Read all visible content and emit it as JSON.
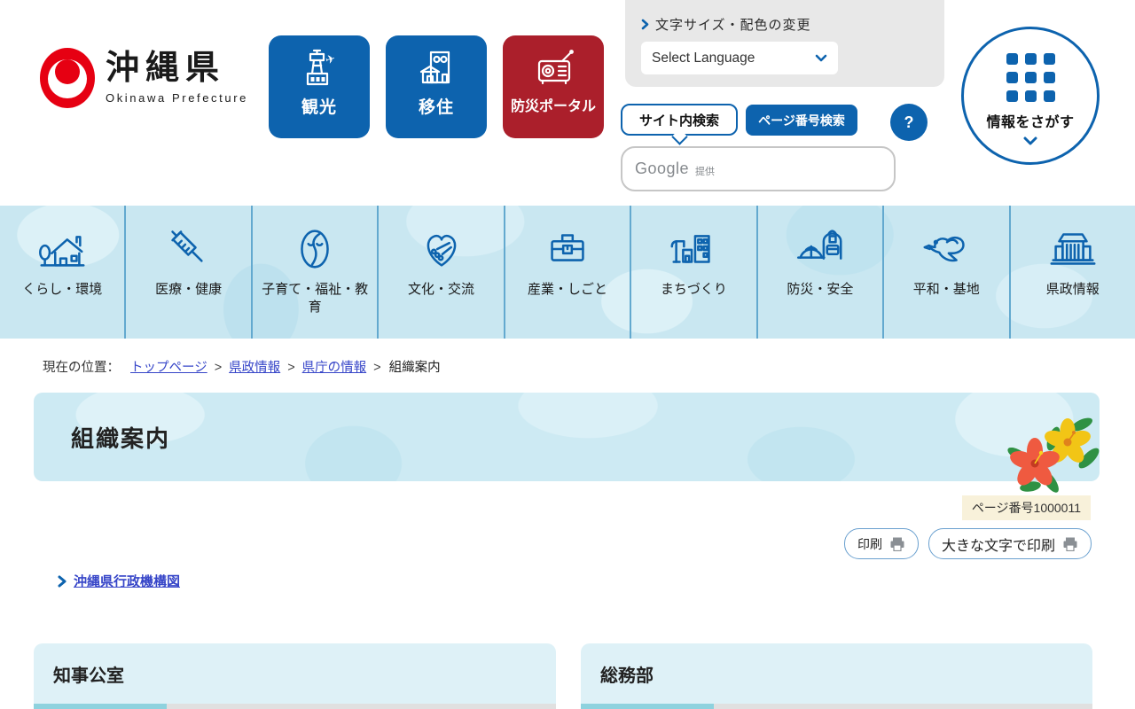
{
  "header": {
    "logo": {
      "title": "沖縄県",
      "subtitle": "Okinawa Prefecture"
    },
    "quick_links": [
      {
        "label": "観光",
        "icon": "airport-icon"
      },
      {
        "label": "移住",
        "icon": "buildings-icon"
      },
      {
        "label": "防災ポータル",
        "icon": "radio-icon"
      }
    ],
    "utility": {
      "text_size_link": "文字サイズ・配色の変更",
      "language_select": "Select Language"
    },
    "search": {
      "site_tab": "サイト内検索",
      "page_number_tab": "ページ番号検索",
      "help": "?",
      "brand": "Google",
      "brand_note": "提供"
    },
    "find_info_label": "情報をさがす"
  },
  "nav": {
    "items": [
      {
        "label": "くらし・環境"
      },
      {
        "label": "医療・健康"
      },
      {
        "label": "子育て・福祉・教育"
      },
      {
        "label": "文化・交流"
      },
      {
        "label": "産業・しごと"
      },
      {
        "label": "まちづくり"
      },
      {
        "label": "防災・安全"
      },
      {
        "label": "平和・基地"
      },
      {
        "label": "県政情報"
      }
    ]
  },
  "breadcrumb": {
    "prefix": "現在の位置：",
    "separator": ">",
    "links": [
      {
        "label": "トップページ"
      },
      {
        "label": "県政情報"
      },
      {
        "label": "県庁の情報"
      }
    ],
    "current": "組織案内"
  },
  "page": {
    "title": "組織案内",
    "page_number_badge": "ページ番号1000011",
    "print_label": "印刷",
    "print_large_label": "大きな文字で印刷",
    "org_chart_link": "沖縄県行政機構図",
    "sections": [
      {
        "title": "知事公室"
      },
      {
        "title": "総務部"
      }
    ]
  },
  "colors": {
    "primary_blue": "#0d63ae",
    "alert_red": "#ab1f2b",
    "logo_red": "#e60012",
    "link_blue": "#3645c8",
    "nav_bg": "#c9e7f1",
    "section_bg": "#def1f7",
    "section_accent": "#8ed2de",
    "badge_bg": "#f8f1da"
  }
}
